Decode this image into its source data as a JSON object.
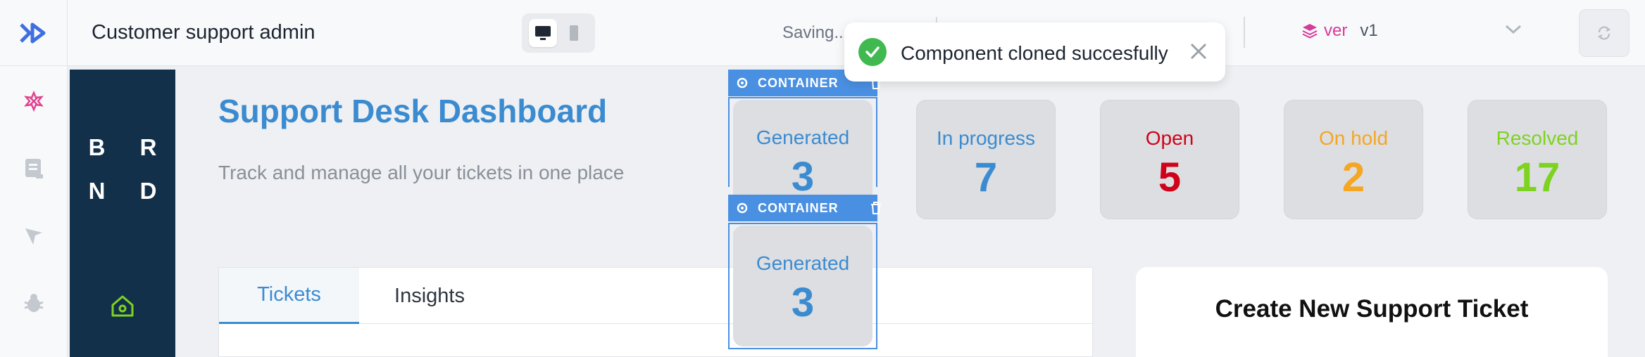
{
  "header": {
    "app_title": "Customer support admin",
    "saving_text": "Saving...",
    "version_label": "ver",
    "version_value": "v1"
  },
  "toast": {
    "message": "Component cloned succesfully",
    "status_color": "#3fb950"
  },
  "brand": {
    "line1": "B R",
    "line2": "N D"
  },
  "dashboard": {
    "title": "Support Desk Dashboard",
    "subtitle": "Track and manage all your tickets in one place"
  },
  "stats": [
    {
      "label": "Generated",
      "value": "3",
      "color": "#3b8bd0"
    },
    {
      "label": "In progress",
      "value": "7",
      "color": "#3b8bd0"
    },
    {
      "label": "Open",
      "value": "5",
      "color": "#d0021b"
    },
    {
      "label": "On hold",
      "value": "2",
      "color": "#f5a623"
    },
    {
      "label": "Resolved",
      "value": "17",
      "color": "#7ed321"
    }
  ],
  "selection": {
    "tag_label": "CONTAINER",
    "clone": {
      "label": "Generated",
      "value": "3"
    }
  },
  "tabs": [
    {
      "label": "Tickets",
      "active": true
    },
    {
      "label": "Insights",
      "active": false
    }
  ],
  "create_ticket": {
    "title": "Create New Support Ticket"
  },
  "icons": {
    "logo": "chevrons-right-icon",
    "sidebar": [
      "plugin-icon",
      "page-icon",
      "megaphone-icon",
      "bug-icon"
    ],
    "brand_home": "home-icon"
  },
  "colors": {
    "accent": "#4a90e2",
    "brand_sidebar": "#13304a",
    "version_pink": "#d63b9a"
  }
}
